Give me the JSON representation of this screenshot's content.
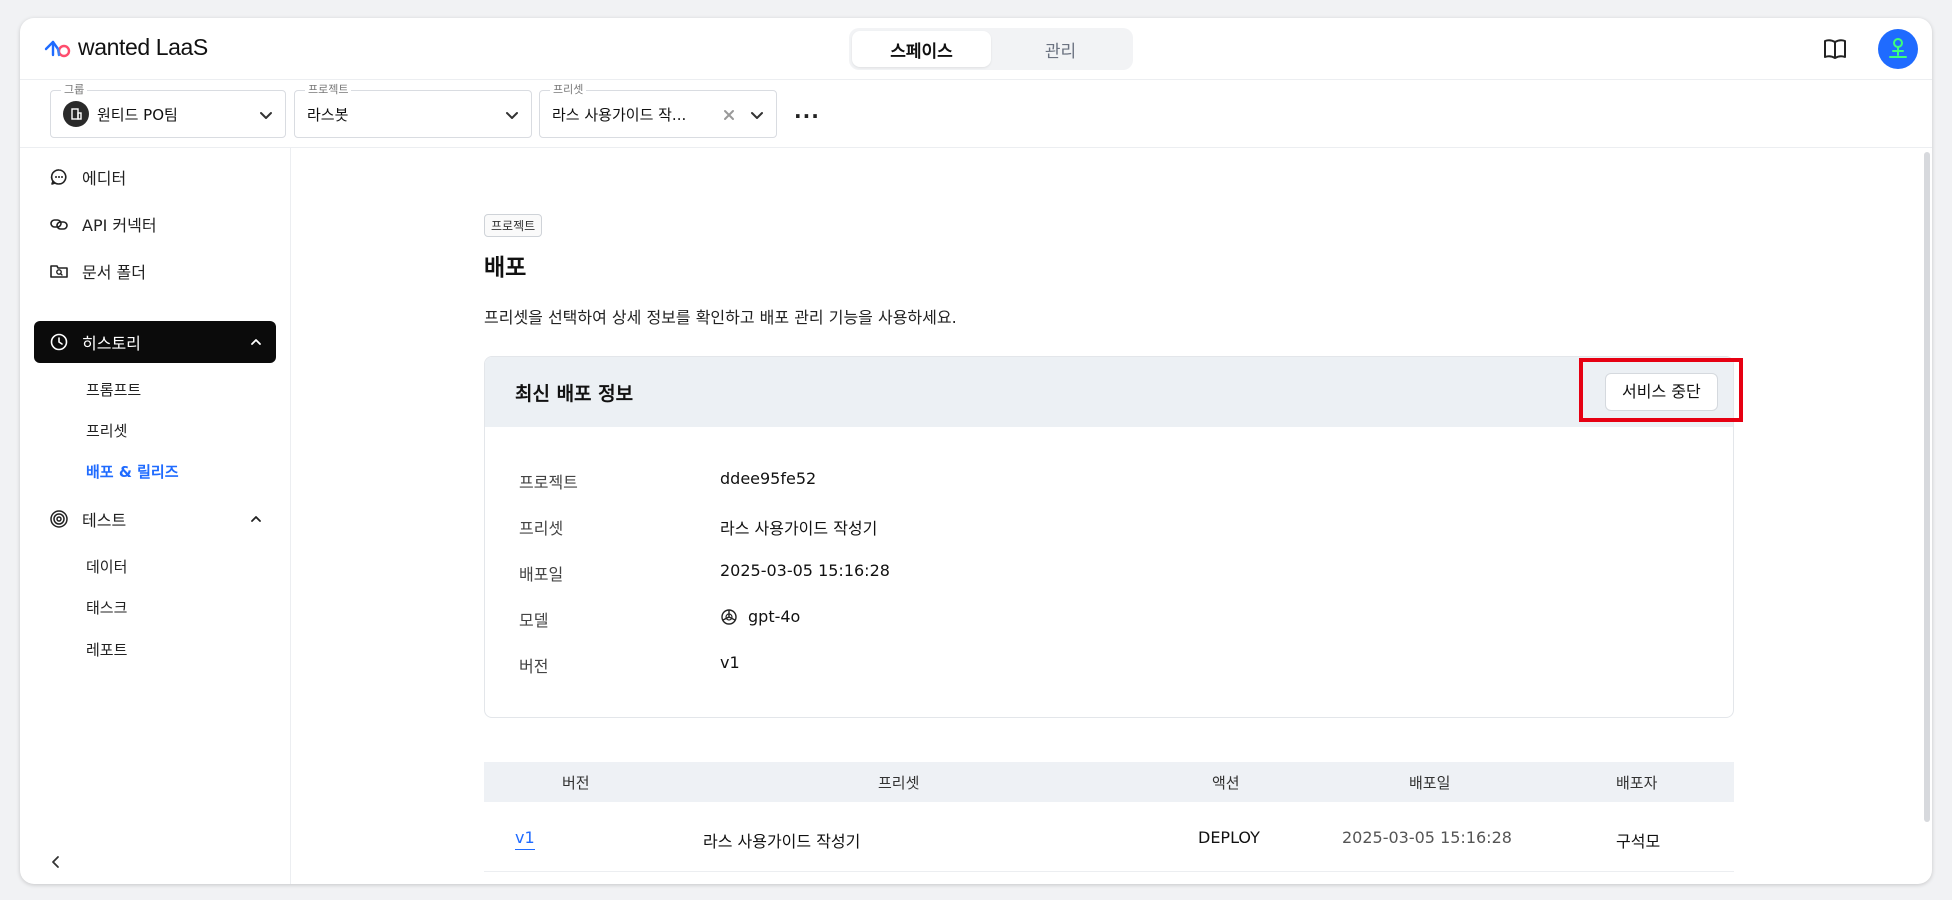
{
  "app": {
    "logo_text": "wanted LaaS"
  },
  "header": {
    "tabs": [
      {
        "label": "스페이스",
        "active": true
      },
      {
        "label": "관리",
        "active": false
      }
    ],
    "icons": [
      "book-icon",
      "avatar"
    ]
  },
  "selectors": {
    "group": {
      "legend": "그룹",
      "value": "원티드 PO팀"
    },
    "project": {
      "legend": "프로젝트",
      "value": "라스봇"
    },
    "preset": {
      "legend": "프리셋",
      "value": "라스 사용가이드 작..."
    },
    "more_label": "···"
  },
  "sidebar": {
    "items": [
      {
        "label": "에디터",
        "icon": "chat-bubble-icon"
      },
      {
        "label": "API 커넥터",
        "icon": "link-icon"
      },
      {
        "label": "문서 폴더",
        "icon": "folder-search-icon"
      },
      {
        "label": "히스토리",
        "icon": "clock-icon",
        "active": true
      },
      {
        "label": "테스트",
        "icon": "target-icon"
      }
    ],
    "history_sub": [
      "프롬프트",
      "프리셋",
      "배포 & 릴리즈"
    ],
    "test_sub": [
      "데이터",
      "태스크",
      "레포트"
    ]
  },
  "main": {
    "chip": "프로젝트",
    "title": "배포",
    "description": "프리셋을 선택하여 상세 정보를 확인하고 배포 관리 기능을 사용하세요.",
    "card": {
      "title": "최신 배포 정보",
      "stop_button": "서비스 중단",
      "rows": [
        {
          "label": "프로젝트",
          "value": "ddee95fe52"
        },
        {
          "label": "프리셋",
          "value": "라스 사용가이드 작성기"
        },
        {
          "label": "배포일",
          "value": "2025-03-05 15:16:28"
        },
        {
          "label": "모델",
          "value": "gpt-4o",
          "icon": "openai-icon"
        },
        {
          "label": "버전",
          "value": "v1"
        }
      ]
    },
    "table": {
      "headers": [
        "버전",
        "프리셋",
        "액션",
        "배포일",
        "배포자"
      ],
      "rows": [
        {
          "version": "v1",
          "preset": "라스 사용가이드 작성기",
          "action": "DEPLOY",
          "date": "2025-03-05 15:16:28",
          "deployer": "구석모"
        }
      ]
    }
  },
  "colors": {
    "accent": "#1f6bff",
    "highlight": "#e60012",
    "active_nav": "#0b0b0b"
  }
}
